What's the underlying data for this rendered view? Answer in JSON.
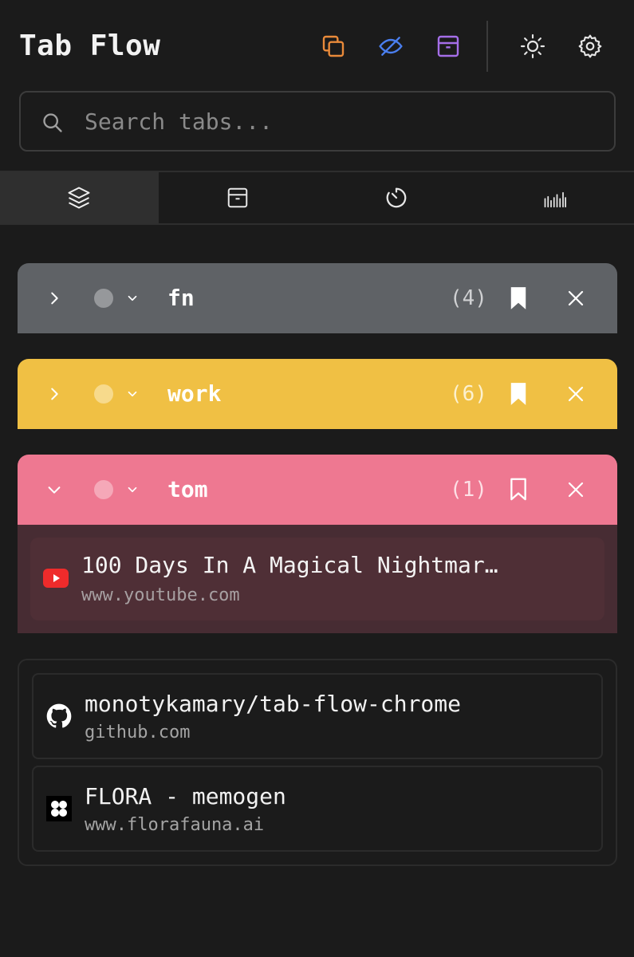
{
  "app": {
    "title": "Tab Flow"
  },
  "header": {
    "icons": [
      "copy-icon",
      "eye-off-icon",
      "archive-icon",
      "sun-icon",
      "gear-icon"
    ],
    "colors": {
      "copy": "#e98a3a",
      "hide": "#4a7ff0",
      "archive": "#a56ee8",
      "neutral": "#e6e6e6"
    }
  },
  "search": {
    "placeholder": "Search tabs..."
  },
  "nav": {
    "tabs": [
      {
        "icon": "layers-icon",
        "active": true
      },
      {
        "icon": "archive-icon",
        "active": false
      },
      {
        "icon": "timer-icon",
        "active": false
      },
      {
        "icon": "stats-icon",
        "active": false
      }
    ]
  },
  "groups": [
    {
      "name": "fn",
      "count": "(4)",
      "color": "#5f6266",
      "expanded": false,
      "bookmarked": true
    },
    {
      "name": "work",
      "count": "(6)",
      "color": "#f0c044",
      "expanded": false,
      "bookmarked": true
    },
    {
      "name": "tom",
      "count": "(1)",
      "color": "#ee7891",
      "expanded": true,
      "bookmarked": false,
      "tabs": [
        {
          "title": "100 Days In A Magical Nightmar…",
          "url": "www.youtube.com",
          "icon": "youtube-icon"
        }
      ]
    }
  ],
  "ungrouped": [
    {
      "title": "monotykamary/tab-flow-chrome",
      "url": "github.com",
      "icon": "github-icon"
    },
    {
      "title": "FLORA - memogen",
      "url": "www.florafauna.ai",
      "icon": "flora-icon"
    }
  ]
}
